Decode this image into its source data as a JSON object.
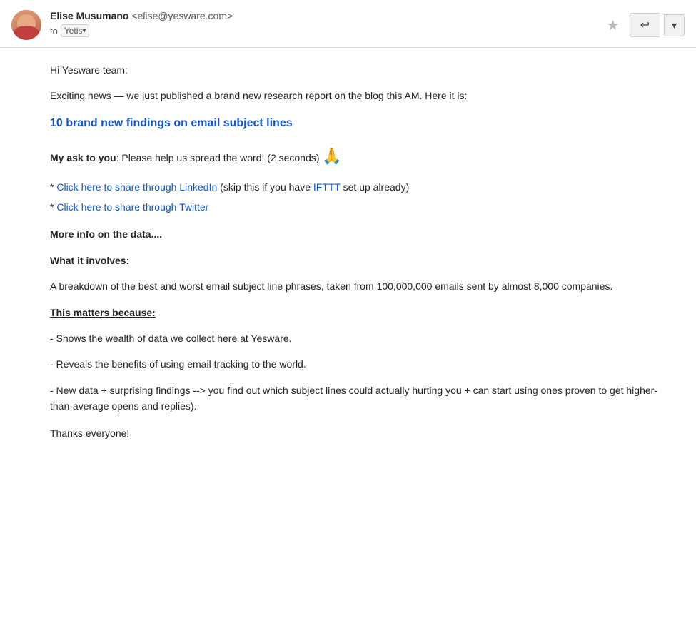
{
  "header": {
    "sender_name": "Elise Musumano",
    "sender_email": "<elise@yesware.com>",
    "recipient_prefix": "to",
    "recipient_name": "Yetis",
    "star_label": "★",
    "reply_label": "↩",
    "more_label": "▾"
  },
  "body": {
    "greeting": "Hi Yesware team:",
    "intro": "Exciting news — we just published a brand new research report on the blog this AM. Here it is:",
    "link_text": "10 brand new findings on email subject lines",
    "ask_label": "My ask to you",
    "ask_text": ": Please help us spread the word! (2 seconds)",
    "pray_emoji": "🙏",
    "linkedin_share": "Click here to share through LinkedIn",
    "linkedin_after": " (skip this if you have ",
    "ifttt_link": "IFTTT",
    "linkedin_end": " set up already)",
    "twitter_share": "Click here to share through Twitter",
    "more_info": "More info on the data....",
    "what_title": "What it involves:",
    "what_body": "A breakdown of the best and worst email subject line phrases, taken from 100,000,000 emails sent by almost 8,000 companies.",
    "why_title": "This matters because:",
    "why_body_1": "- Shows the wealth of data we collect here at Yesware.",
    "why_body_2": "- Reveals the benefits of using email tracking to the world.",
    "why_body_3": "- New data + surprising findings --> you find out which subject lines could actually hurting you + can start using ones proven to get higher-than-average opens and replies).",
    "thanks": "Thanks everyone!"
  },
  "colors": {
    "link": "#1155cc",
    "text": "#222222",
    "subtle": "#555555",
    "border": "#e0e0e0",
    "button_bg": "#f1f1f1"
  }
}
